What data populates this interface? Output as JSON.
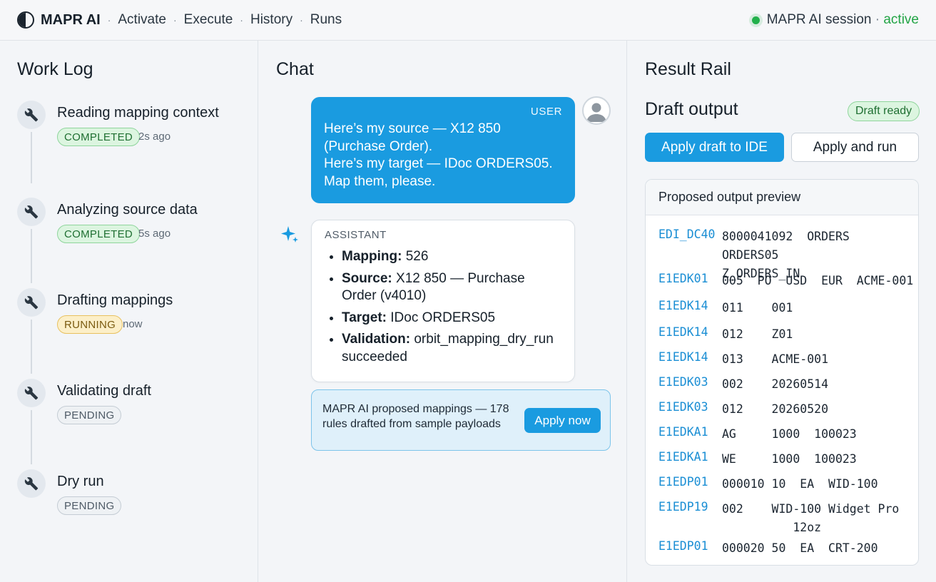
{
  "nav": {
    "brand": "MAPR AI",
    "sep": "·",
    "links": [
      "Activate",
      "Execute",
      "History",
      "Runs"
    ],
    "session_label": "MAPR AI session",
    "session_sep": " · ",
    "session_state": "active"
  },
  "work_log": {
    "title": "Work Log",
    "steps": [
      {
        "title": "Reading mapping context",
        "status": "COMPLETED",
        "time": "2s ago"
      },
      {
        "title": "Analyzing source data",
        "status": "COMPLETED",
        "time": "5s ago"
      },
      {
        "title": "Drafting mappings",
        "status": "RUNNING",
        "time": "now"
      },
      {
        "title": "Validating draft",
        "status": "PENDING",
        "time": ""
      },
      {
        "title": "Dry run",
        "status": "PENDING",
        "time": ""
      }
    ]
  },
  "chat": {
    "title": "Chat",
    "user": {
      "role": "USER",
      "lines": [
        "Here’s my source — X12 850 (Purchase Order).",
        "Here’s my target — IDoc ORDERS05.",
        "Map them, please."
      ]
    },
    "assistant": {
      "role": "ASSISTANT",
      "items": [
        {
          "label": "Mapping:",
          "value": " 526"
        },
        {
          "label": "Source:",
          "value": " X12 850 — Purchase Order (v4010)"
        },
        {
          "label": "Target:",
          "value": " IDoc ORDERS05"
        },
        {
          "label": "Validation:",
          "value": " orbit_mapping_dry_run succeeded"
        }
      ]
    },
    "proposal": {
      "text": "MAPR AI proposed mappings — 178 rules drafted from sample payloads",
      "button": "Apply now"
    }
  },
  "result_rail": {
    "title": "Result Rail",
    "draft_title": "Draft output",
    "draft_badge": "Draft ready",
    "apply_ide": "Apply draft to IDE",
    "apply_run": "Apply and run",
    "preview_title": "Proposed output preview",
    "segments": [
      {
        "name": "EDI_DC40",
        "values": "8000041092  ORDERS  ORDERS05\nZ_ORDERS_IN"
      },
      {
        "name": "E1EDK01",
        "values": "005  PO  USD  EUR  ACME-001"
      },
      {
        "name": "E1EDK14",
        "values": "011    001"
      },
      {
        "name": "E1EDK14",
        "values": "012    Z01"
      },
      {
        "name": "E1EDK14",
        "values": "013    ACME-001"
      },
      {
        "name": "E1EDK03",
        "values": "002    20260514"
      },
      {
        "name": "E1EDK03",
        "values": "012    20260520"
      },
      {
        "name": "E1EDKA1",
        "values": "AG     1000  100023"
      },
      {
        "name": "E1EDKA1",
        "values": "WE     1000  100023"
      },
      {
        "name": "E1EDP01",
        "values": "000010 10  EA  WID-100"
      },
      {
        "name": "E1EDP19",
        "values": "002    WID-100 Widget Pro\n          12oz"
      },
      {
        "name": "E1EDP01",
        "values": "000020 50  EA  CRT-200"
      }
    ]
  },
  "colors": {
    "accent": "#1a9be0",
    "completed": "#dcf5e0",
    "running": "#fcefc8",
    "pending": "#eef1f4",
    "active": "#22b04b"
  }
}
